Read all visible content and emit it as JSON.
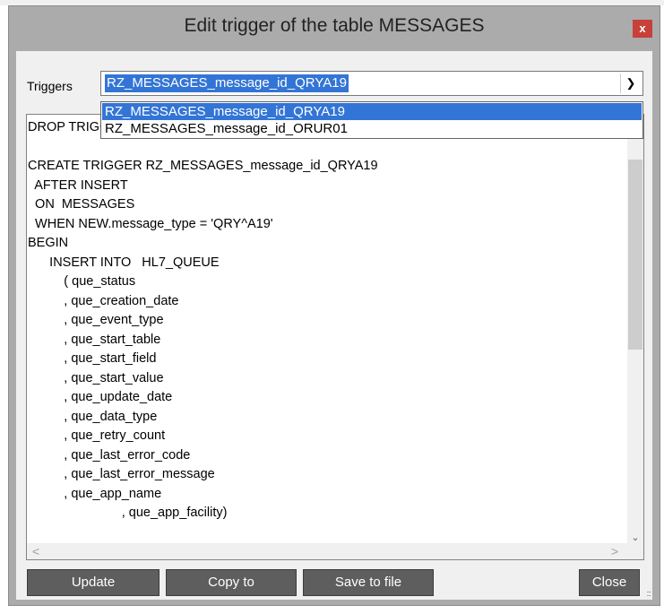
{
  "window": {
    "title": "Edit trigger of the table MESSAGES",
    "close_glyph": "x"
  },
  "triggers": {
    "label": "Triggers",
    "selected": "RZ_MESSAGES_message_id_QRYA19",
    "options": [
      "RZ_MESSAGES_message_id_QRYA19",
      "RZ_MESSAGES_message_id_ORUR01"
    ]
  },
  "editor": {
    "lines": [
      "DROP TRIGGER IF EXISTS RZ_MESSAGES_message_id_QRYA19;",
      "",
      "CREATE TRIGGER RZ_MESSAGES_message_id_QRYA19",
      "  AFTER INSERT",
      "  ON  MESSAGES",
      "  WHEN NEW.message_type = 'QRY^A19'",
      "BEGIN",
      "      INSERT INTO   HL7_QUEUE",
      "          ( que_status",
      "          , que_creation_date",
      "          , que_event_type",
      "          , que_start_table",
      "          , que_start_field",
      "          , que_start_value",
      "          , que_update_date",
      "          , que_data_type",
      "          , que_retry_count",
      "          , que_last_error_code",
      "          , que_last_error_message",
      "          , que_app_name",
      "                          , que_app_facility)"
    ]
  },
  "buttons": {
    "update": "Update",
    "copy_to": "Copy to",
    "save_to_file": "Save to file",
    "close": "Close"
  },
  "colors": {
    "selection": "#3375d6",
    "window_frame": "#ababab",
    "button": "#5e5e5e",
    "close_button": "#c7403a"
  }
}
